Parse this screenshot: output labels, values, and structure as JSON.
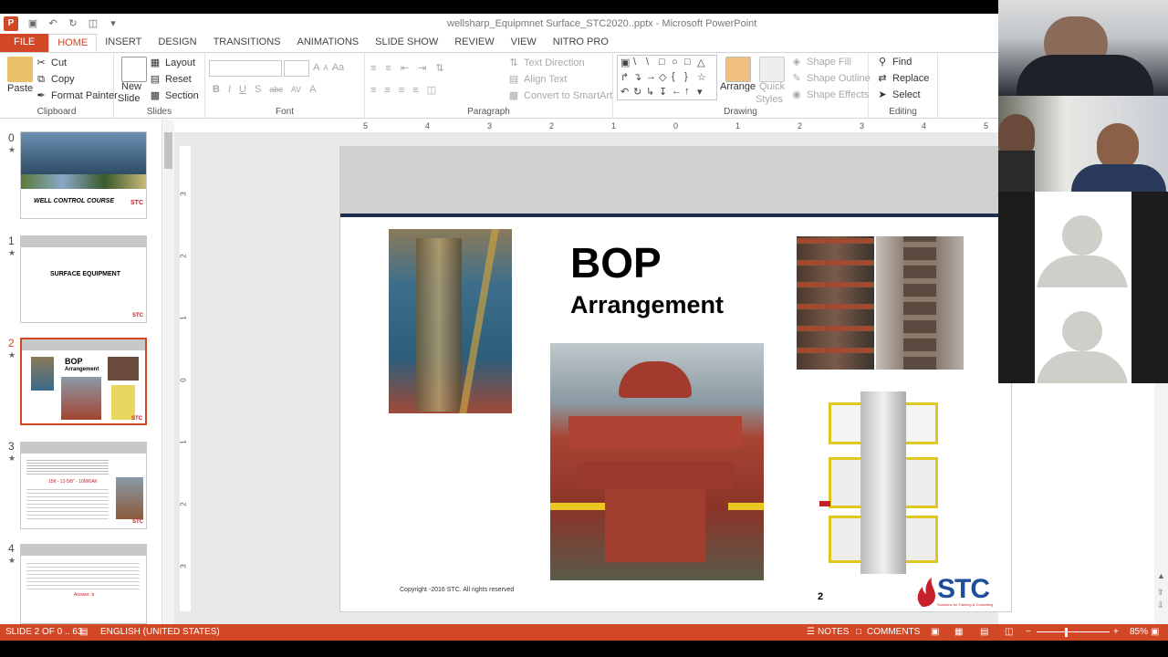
{
  "app": {
    "window_title": "wellsharp_Equipmnet Surface_STC2020..pptx - Microsoft PowerPoint",
    "logo": "P"
  },
  "tabs": [
    "FILE",
    "HOME",
    "INSERT",
    "DESIGN",
    "TRANSITIONS",
    "ANIMATIONS",
    "SLIDE SHOW",
    "REVIEW",
    "VIEW",
    "NITRO PRO"
  ],
  "active_tab": "HOME",
  "ribbon": {
    "clipboard": {
      "label": "Clipboard",
      "paste": "Paste",
      "cut": "Cut",
      "copy": "Copy",
      "format_painter": "Format Painter"
    },
    "slides": {
      "label": "Slides",
      "new_slide_1": "New",
      "new_slide_2": "Slide",
      "layout": "Layout",
      "reset": "Reset",
      "section": "Section"
    },
    "font": {
      "label": "Font",
      "bold": "B",
      "italic": "I",
      "underline": "U",
      "shadow": "S",
      "strike": "abc",
      "spacing": "AV",
      "case": "Aa",
      "color": "A"
    },
    "paragraph": {
      "label": "Paragraph",
      "text_direction": "Text Direction",
      "align_text": "Align Text",
      "convert": "Convert to SmartArt"
    },
    "drawing": {
      "label": "Drawing",
      "arrange": "Arrange",
      "quick_1": "Quick",
      "quick_2": "Styles",
      "shape_fill": "Shape Fill",
      "shape_outline": "Shape Outline",
      "shape_effects": "Shape Effects"
    },
    "editing": {
      "label": "Editing",
      "find": "Find",
      "replace": "Replace",
      "select": "Select"
    }
  },
  "ruler": {
    "h": [
      "5",
      "4",
      "3",
      "2",
      "1",
      "0",
      "1",
      "2",
      "3",
      "4",
      "5"
    ],
    "v": [
      "3",
      "2",
      "1",
      "0",
      "1",
      "2",
      "3"
    ]
  },
  "thumbnails": [
    {
      "num": "0",
      "text": "WELL CONTROL COURSE",
      "logo": "STC"
    },
    {
      "num": "1",
      "text": "SURFACE EQUIPMENT",
      "logo": "STC"
    },
    {
      "num": "2",
      "text": "BOP",
      "sub": "Arrangement",
      "logo": "STC"
    },
    {
      "num": "3",
      "text": "15ft - 13-5/8\" - 10M/6AK",
      "logo": "STC"
    },
    {
      "num": "4",
      "text": "Answer: b",
      "logo": ""
    }
  ],
  "slide": {
    "title": "BOP",
    "subtitle": "Arrangement",
    "copyright": "Copyright -2016 STC. All rights reserved",
    "number": "2",
    "logo": "STC",
    "logo_tagline": "Solutions for Training & Consulting"
  },
  "status": {
    "slide_info": "SLIDE 2 OF 0 .. 63",
    "language": "ENGLISH (UNITED STATES)",
    "notes": "NOTES",
    "comments": "COMMENTS",
    "zoom": "85%"
  },
  "colors": {
    "accent": "#d24726",
    "slide_line": "#1f2d4e",
    "ribbon_bg": "#ffffff"
  }
}
